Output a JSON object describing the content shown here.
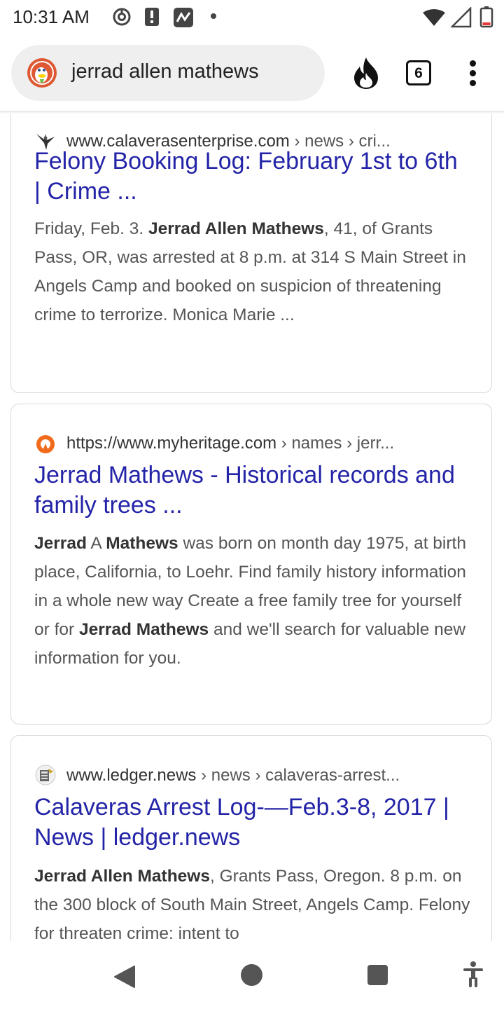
{
  "status_bar": {
    "time": "10:31 AM",
    "icons": [
      "chrome-icon",
      "alert-icon",
      "activity-icon",
      "dot-icon",
      "wifi-icon",
      "signal-icon",
      "battery-low-icon"
    ]
  },
  "search": {
    "query": "jerrad allen mathews",
    "tab_count": "6",
    "icons": [
      "duckduckgo-logo",
      "fire-icon",
      "tabs-icon",
      "more-vert-icon"
    ]
  },
  "results": [
    {
      "domain": "www.calaverasenterprise.com",
      "path": " › news › cri...",
      "title": "Felony Booking Log: February 1st to 6th | Crime ...",
      "snippet": [
        {
          "t": "Friday, Feb. 3. ",
          "b": false
        },
        {
          "t": "Jerrad Allen Mathews",
          "b": true
        },
        {
          "t": ", 41, of Grants Pass, OR, was arrested at 8 p.m. at 314 S Main Street in Angels Camp and booked on suspicion of threatening crime to terrorize. Monica Marie ...",
          "b": false
        }
      ],
      "favicon": "eagle-icon"
    },
    {
      "domain": "https://www.myheritage.com",
      "path": " › names › jerr...",
      "title": "Jerrad Mathews - Historical records and family trees ...",
      "snippet": [
        {
          "t": "Jerrad",
          "b": true
        },
        {
          "t": " A ",
          "b": false
        },
        {
          "t": "Mathews",
          "b": true
        },
        {
          "t": " was born on month day 1975, at birth place, California, to Loehr. Find family history information in a whole new way Create a free family tree for yourself or for ",
          "b": false
        },
        {
          "t": "Jerrad Mathews",
          "b": true
        },
        {
          "t": " and we'll search for valuable new information for you.",
          "b": false
        }
      ],
      "favicon": "myheritage-icon"
    },
    {
      "domain": "www.ledger.news",
      "path": " › news › calaveras-arrest...",
      "title": "Calaveras Arrest Log-—Feb.3-8, 2017 | News | ledger.news",
      "snippet": [
        {
          "t": "Jerrad Allen Mathews",
          "b": true
        },
        {
          "t": ", Grants Pass, Oregon. 8 p.m. on the 300 block of South Main Street, Angels Camp. Felony for threaten crime: intent to",
          "b": false
        }
      ],
      "favicon": "ledger-icon"
    }
  ],
  "nav_bar": {
    "icons": [
      "back-icon",
      "home-icon",
      "recents-icon",
      "accessibility-icon"
    ]
  },
  "colors": {
    "title_link": "#2424a8",
    "snippet_text": "#555555",
    "searchbox_bg": "#efefef",
    "ddg_orange": "#de5833"
  }
}
